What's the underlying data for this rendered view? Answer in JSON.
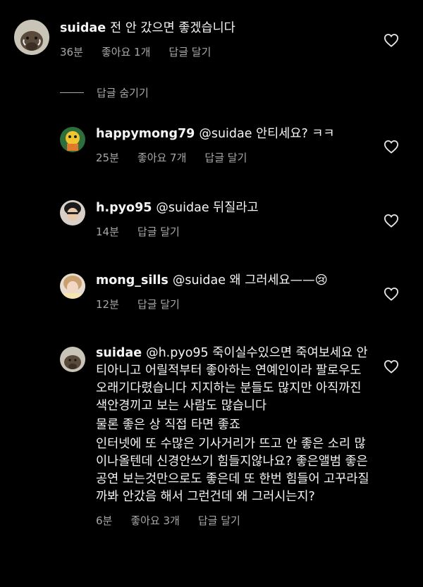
{
  "main_comment": {
    "username": "suidae",
    "text": "전 안 갔으면 좋겠습니다",
    "time": "36분",
    "likes": "좋아요 1개",
    "reply_label": "답글 달기"
  },
  "hide_replies_label": "답글 숨기기",
  "replies": [
    {
      "username": "happymong79",
      "text": "@suidae 안티세요? ㅋㅋ",
      "time": "25분",
      "likes": "좋아요 7개",
      "reply_label": "답글 달기"
    },
    {
      "username": "h.pyo95",
      "text": "@suidae 뒤질라고",
      "time": "14분",
      "reply_label": "답글 달기"
    },
    {
      "username": "mong_sills",
      "text": "@suidae 왜 그러세요——😢",
      "time": "12분",
      "reply_label": "답글 달기"
    },
    {
      "username": "suidae",
      "paragraphs": [
        "@h.pyo95 죽이실수있으면 죽여보세요 안티아니고 어릴적부터 좋아하는 연예인이라 팔로우도 오래기다렸습니다 지지하는 분들도 많지만 아직까진 색안경끼고 보는 사람도 많습니다",
        "물론 좋은 상 직접 타면 좋죠",
        "인터넷에 또 수많은 기사거리가 뜨고 안 좋은 소리 많이나올텐데 신경안쓰기 힘들지않나요? 좋은앨범 좋은공연 보는것만으로도 좋은데 또 한번 힘들어 고꾸라질까봐 안갔음 해서 그런건데 왜 그러시는지?"
      ],
      "time": "6분",
      "likes": "좋아요 3개",
      "reply_label": "답글 달기"
    }
  ],
  "icons": {
    "heart": "heart-outline-icon"
  },
  "colors": {
    "background": "#000000",
    "text": "#f5f5f5",
    "meta": "#a8a8a8"
  }
}
